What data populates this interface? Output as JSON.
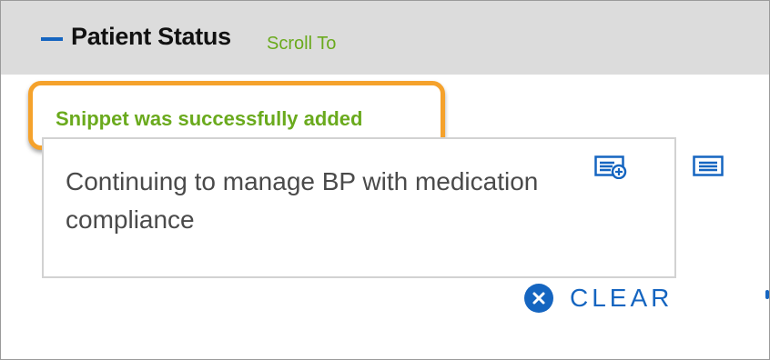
{
  "section": {
    "title": "Patient Status",
    "scroll_link": "Scroll To"
  },
  "notification": {
    "message": "Snippet was successfully added"
  },
  "note": {
    "text": "Continuing to manage BP with medication compliance"
  },
  "actions": {
    "clear_label": "CLEAR"
  },
  "icons": {
    "collapse": "minus-icon",
    "add_snippet": "add-snippet-icon",
    "snippet_list": "snippet-list-icon",
    "clear": "close-circle-icon"
  },
  "colors": {
    "header_bg": "#dcdcdc",
    "accent_blue": "#1565c0",
    "success_green": "#6aaa1d",
    "highlight_orange": "#f5a22c"
  }
}
